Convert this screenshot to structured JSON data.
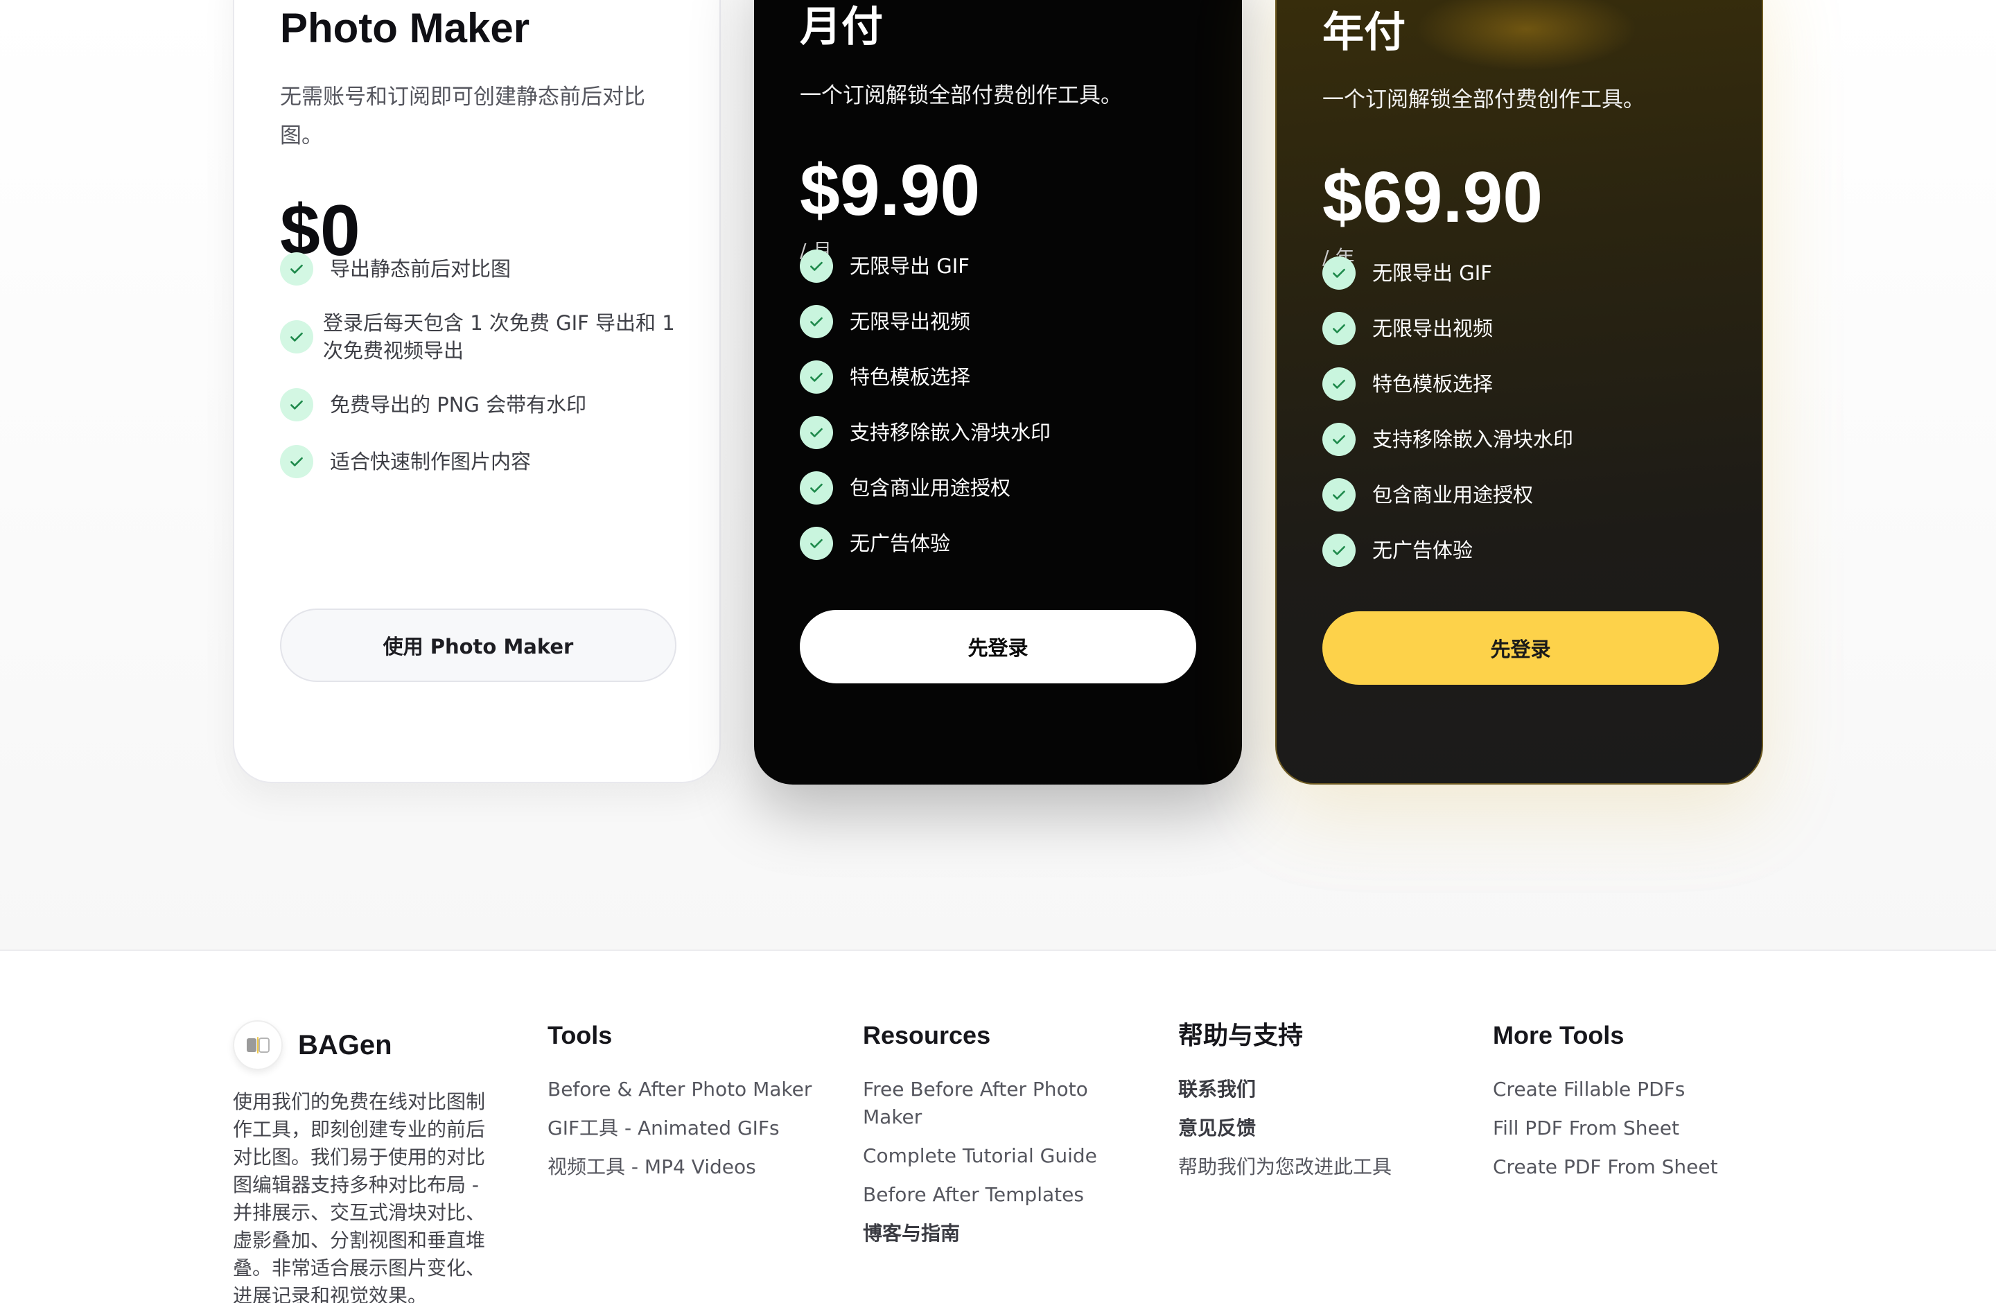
{
  "colors": {
    "check_bg": "#d3f7e3",
    "check_mark": "#1f8a4c",
    "yearly_button": "#fdd24a",
    "monthly_card": "#050505",
    "yearly_card": "#2a2410"
  },
  "plans": {
    "free": {
      "title": "Photo Maker",
      "description": "无需账号和订阅即可创建静态前后对比图。",
      "price": "$0",
      "features": [
        "导出静态前后对比图",
        "登录后每天包含 1 次免费 GIF 导出和 1 次免费视频导出",
        "免费导出的 PNG 会带有水印",
        "适合快速制作图片内容"
      ],
      "button": "使用 Photo Maker"
    },
    "monthly": {
      "title": "月付",
      "description": "一个订阅解锁全部付费创作工具。",
      "price": "$9.90",
      "period": "/ 月",
      "features": [
        "无限导出 GIF",
        "无限导出视频",
        "特色模板选择",
        "支持移除嵌入滑块水印",
        "包含商业用途授权",
        "无广告体验"
      ],
      "button": "先登录"
    },
    "yearly": {
      "title": "年付",
      "description": "一个订阅解锁全部付费创作工具。",
      "price": "$69.90",
      "period": "/ 年",
      "features": [
        "无限导出 GIF",
        "无限导出视频",
        "特色模板选择",
        "支持移除嵌入滑块水印",
        "包含商业用途授权",
        "无广告体验"
      ],
      "button": "先登录"
    }
  },
  "footer": {
    "brand": {
      "name": "BAGen",
      "description": "使用我们的免费在线对比图制作工具，即刻创建专业的前后对比图。我们易于使用的对比图编辑器支持多种对比布局 - 并排展示、交互式滑块对比、虚影叠加、分割视图和垂直堆叠。非常适合展示图片变化、进展记录和视觉效果。"
    },
    "tools": {
      "heading": "Tools",
      "links": [
        "Before & After Photo Maker",
        "GIF工具 - Animated GIFs",
        "视频工具 - MP4 Videos"
      ]
    },
    "resources": {
      "heading": "Resources",
      "links": [
        "Free Before After Photo Maker",
        "Complete Tutorial Guide",
        "Before After Templates",
        "博客与指南"
      ]
    },
    "help": {
      "heading": "帮助与支持",
      "links": [
        "联系我们",
        "意见反馈",
        "帮助我们为您改进此工具"
      ]
    },
    "more": {
      "heading": "More Tools",
      "links": [
        "Create Fillable PDFs",
        "Fill PDF From Sheet",
        "Create PDF From Sheet"
      ]
    }
  }
}
